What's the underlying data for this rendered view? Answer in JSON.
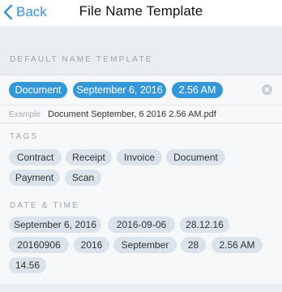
{
  "nav": {
    "back_label": "Back",
    "title": "File Name Template"
  },
  "default_template": {
    "header": "DEFAULT NAME TEMPLATE",
    "selected": [
      "Document",
      "September 6, 2016",
      "2.56 AM"
    ],
    "example_label": "Example",
    "example_value": "Document September, 6 2016 2.56 AM.pdf"
  },
  "tags": {
    "header": "TAGS",
    "items": [
      "Contract",
      "Receipt",
      "Invoice",
      "Document",
      "Payment",
      "Scan"
    ]
  },
  "date_time": {
    "header": "DATE & TIME",
    "items": [
      "September 6, 2016",
      "2016-09-06",
      "28.12.16",
      "20160906",
      "2016",
      "September",
      "28",
      "2.56 AM",
      "14.56"
    ]
  },
  "colors": {
    "accent": "#3498d8",
    "chip_bg": "#dbe4ec",
    "back_text": "#3a8fd6"
  }
}
